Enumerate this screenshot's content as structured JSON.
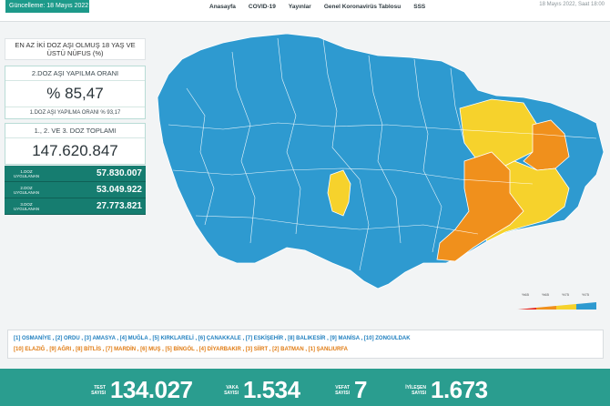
{
  "header": {
    "date_left": "Güncelleme: 18 Mayıs 2022",
    "date_right": "18 Mayıs 2022, Saat 18:00",
    "nav": [
      "Anasayfa",
      "COVID-19",
      "Yayınlar",
      "Genel Koronavirüs Tablosu",
      "SSS"
    ]
  },
  "left_panel": {
    "title": "EN AZ İKİ DOZ AŞI OLMUŞ 18 YAŞ VE ÜSTÜ NÜFUS (%)",
    "rate_label": "2.DOZ AŞI YAPILMA ORANI",
    "rate_value": "% 85,47",
    "rate_first_dose": "1.DOZ AŞI YAPILMA ORANI  % 93,17",
    "total_label": "1., 2. VE 3. DOZ TOPLAMI",
    "total_value": "147.620.847",
    "doses": [
      {
        "label": "1.DOZ UYGULANAN",
        "value": "57.830.007"
      },
      {
        "label": "2.DOZ UYGULANAN",
        "value": "53.049.922"
      },
      {
        "label": "3.DOZ UYGULANAN",
        "value": "27.773.821"
      }
    ]
  },
  "legend": {
    "labels": [
      "%65",
      "%65",
      "%75",
      "%75"
    ],
    "colors": [
      "#e8261f",
      "#f0901c",
      "#f6d22c",
      "#2e9ad0"
    ]
  },
  "rankings": {
    "top": "[1] OSMANİYE , [2] ORDU , [3] AMASYA , [4] MUĞLA , [5] KIRKLARELİ , [6] ÇANAKKALE , [7] ESKİŞEHİR , [8] BALIKESİR , [9] MANİSA , [10] ZONGULDAK",
    "bottom": "[10] ELAZIĞ , [9] AĞRI , [8] BİTLİS , [7] MARDİN , [6] MUŞ , [5] BİNGÖL , [4] DİYARBAKIR , [3] SİİRT , [2] BATMAN , [1] ŞANLIURFA"
  },
  "stats": [
    {
      "label": "TEST SAYISI",
      "value": "134.027"
    },
    {
      "label": "VAKA SAYISI",
      "value": "1.534"
    },
    {
      "label": "VEFAT SAYISI",
      "value": "7"
    },
    {
      "label": "İYİLEŞEN SAYISI",
      "value": "1.673"
    }
  ],
  "colors": {
    "map_blue": "#2e9ad0",
    "map_yellow": "#f6d22c",
    "map_orange": "#f0901c",
    "accent": "#2a9d8f"
  }
}
